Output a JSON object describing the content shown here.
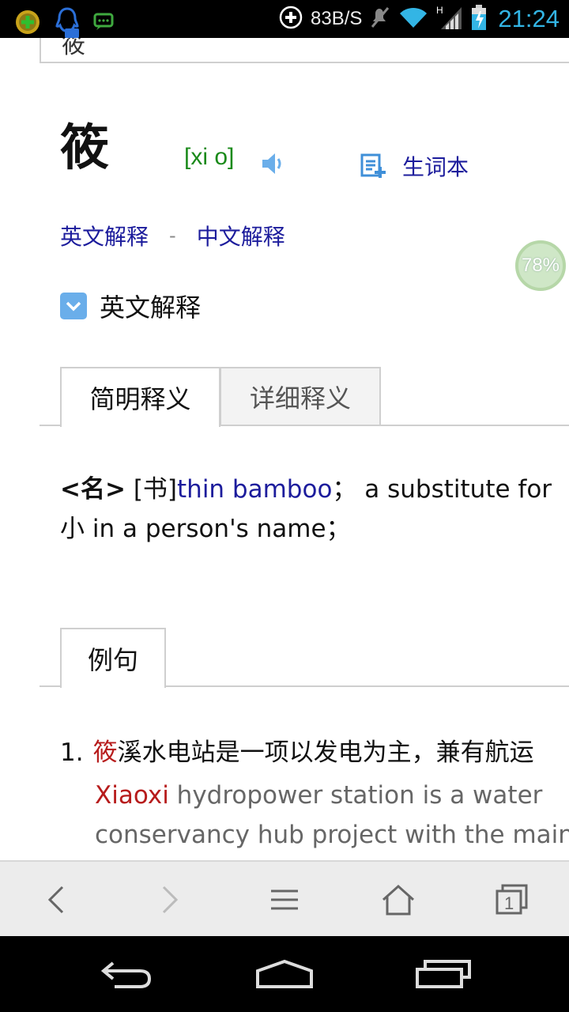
{
  "status_bar": {
    "net_speed": "83B/S",
    "time": "21:24",
    "icons": [
      "plus-circle-icon",
      "qq-icon",
      "chat-icon",
      "add-circle-icon",
      "mute-icon",
      "wifi-icon",
      "signal-icon",
      "battery-icon"
    ]
  },
  "search": {
    "partial_text": "筱"
  },
  "entry": {
    "headword": "筱",
    "phonetic": "[xi  o]",
    "wordbook_label": "生词本"
  },
  "links": {
    "english": "英文解释",
    "separator": "-",
    "chinese": "中文解释"
  },
  "progress": {
    "percent_label": "78%",
    "percent": 78
  },
  "section": {
    "title": "英文解释"
  },
  "tabs": [
    {
      "label": "简明释义",
      "active": true
    },
    {
      "label": "详细释义",
      "active": false
    }
  ],
  "definition": {
    "pos": "<名>",
    "tag": "[书]",
    "gloss": "thin bamboo",
    "sep1": "；",
    "rest1": "a substitute for",
    "rest2": "小 in a person's name；"
  },
  "example_tab": {
    "label": "例句"
  },
  "examples": [
    {
      "number": "1.",
      "cn_highlight": "筱",
      "cn_rest": "溪水电站是一项以发电为主，兼有航运",
      "en_highlight": "Xiaoxi",
      "en_rest1": " hydropower station is a water",
      "en_rest2": "conservancy hub project with the main"
    }
  ],
  "toolbar": {
    "back": "back-icon",
    "forward": "forward-icon",
    "menu": "menu-icon",
    "home": "home-icon",
    "tabs_count": "1"
  },
  "colors": {
    "link": "#1c1c9c",
    "phonetic": "#1a8a1a",
    "highlight": "#b71c1c",
    "clock": "#33b5e5"
  }
}
